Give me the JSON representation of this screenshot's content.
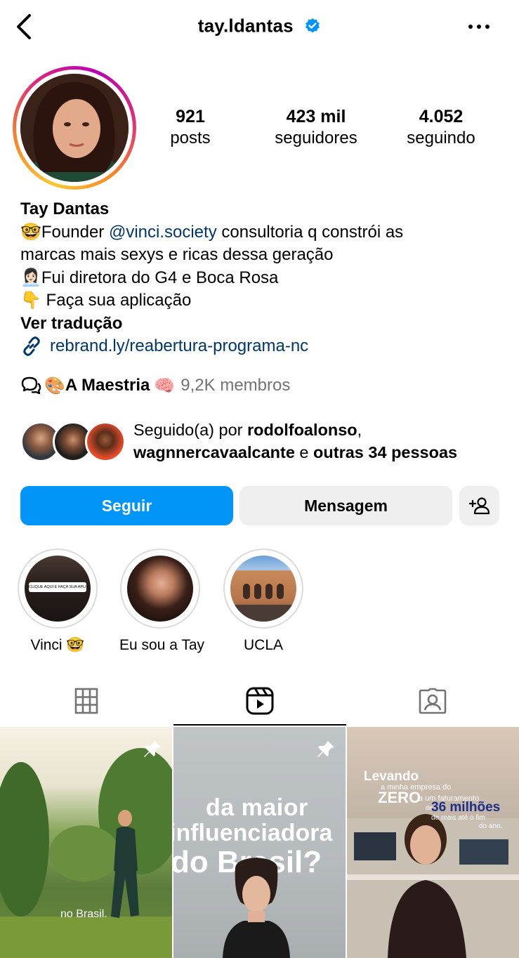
{
  "header": {
    "username": "tay.ldantas",
    "back_icon": "chevron-left-icon",
    "verified_icon": "verified-badge-icon",
    "more_icon": "more-horizontal-icon"
  },
  "stats": [
    {
      "value": "921",
      "label": "posts"
    },
    {
      "value": "423 mil",
      "label": "seguidores"
    },
    {
      "value": "4.052",
      "label": "seguindo"
    }
  ],
  "bio": {
    "name": "Tay Dantas",
    "line1_emoji": "🤓",
    "line1_pre": "Founder ",
    "line1_mention": "@vinci.society",
    "line1_post": " consultoria q constrói as",
    "line2": "marcas mais sexys e ricas dessa geração",
    "line3_emoji": "👩🏻‍💼",
    "line3": "Fui diretora do G4 e Boca Rosa",
    "line4_emoji": "👇",
    "line4": " Faça sua aplicação",
    "translate": "Ver tradução",
    "link": "rebrand.ly/reabertura-programa-nc"
  },
  "channel": {
    "emoji_left": "🎨",
    "name": "A Maestria",
    "emoji_right": "🧠",
    "members": "9,2K membros"
  },
  "followed_by": {
    "prefix": "Seguido(a) por ",
    "user1": "rodolfoalonso",
    "sep": ",",
    "user2": "wagnnercavaalcante",
    "conj": " e ",
    "others": "outras 34 pessoas"
  },
  "buttons": {
    "follow": "Seguir",
    "message": "Mensagem",
    "add_user_icon": "add-user-icon"
  },
  "highlights": [
    {
      "label": "Vinci 🤓",
      "inner_text": "CLIQUE AQUI E FAÇA SUA APLICAÇÃO"
    },
    {
      "label": "Eu sou a Tay"
    },
    {
      "label": "UCLA"
    }
  ],
  "tabs": [
    {
      "name": "grid",
      "icon": "grid-icon",
      "active": false
    },
    {
      "name": "reels",
      "icon": "reels-icon",
      "active": true
    },
    {
      "name": "tagged",
      "icon": "tagged-icon",
      "active": false
    }
  ],
  "posts": [
    {
      "caption": "no Brasil.",
      "pinned": true
    },
    {
      "caption_line1": "da maior",
      "caption_line2": "influenciadora",
      "caption_line3": "do Brasil?",
      "pinned": true
    },
    {
      "caption_line1": "Levando",
      "caption_line2": "a minha empresa do",
      "caption_line3": "ZERO",
      "caption_line4": "a um faturamento",
      "caption_line5": "de",
      "caption_line6": "36 milhões",
      "caption_line7": "de reais até o fim",
      "caption_line8": "do ano.",
      "pinned": false
    }
  ],
  "colors": {
    "follow_blue": "#0095f6",
    "link_blue": "#00376b",
    "muted_gray": "#737373",
    "button_gray": "#efefef"
  }
}
